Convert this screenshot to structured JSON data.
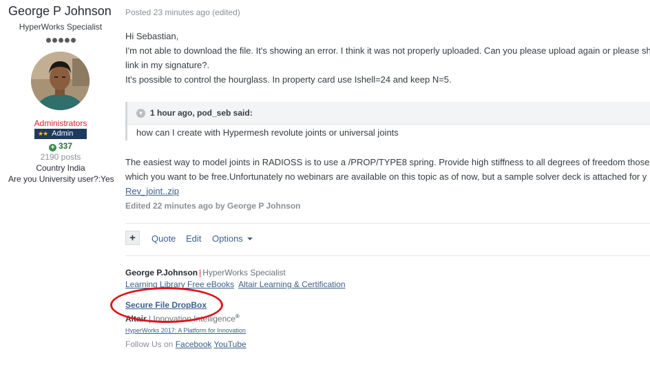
{
  "author": {
    "name": "George P Johnson",
    "title": "HyperWorks Specialist",
    "group": "Administrators",
    "badge_label": "Admin",
    "reputation": "337",
    "posts": "2190 posts",
    "country": "Country India",
    "university": "Are you University user?:Yes"
  },
  "post": {
    "posted": "Posted 23 minutes ago (edited)",
    "lines": [
      "Hi Sebastian,",
      "I'm not able to download the file. It's showing an error. I think it was not properly uploaded. Can you please upload again or please sh",
      "link in my signature?.",
      "It's possible to control the hourglass. In property card use Ishell=24 and keep N=5."
    ],
    "quote": {
      "author": "1 hour ago, pod_seb said:",
      "text": "how can I create with Hypermesh revolute joints or universal joints"
    },
    "answer_lines": [
      " The easiest way to model joints in RADIOSS is to use a /PROP/TYPE8 spring. Provide high stiffness to all degrees of freedom those",
      "which you want to be free.Unfortunately no webinars are available on this topic as of now, but a sample solver deck is attached for y"
    ],
    "attachment": "Rev_joint..zip",
    "edited": "Edited 22 minutes ago by George P Johnson"
  },
  "actions": {
    "plus": "+",
    "quote": "Quote",
    "edit": "Edit",
    "options": "Options"
  },
  "signature": {
    "name": "George P.Johnson",
    "separator": "|",
    "role": "HyperWorks Specialist",
    "links": [
      "Learning Library Free eBooks",
      "Altair Learning & Certification"
    ],
    "dropbox": "Secure File DropBox",
    "brand": "Altair",
    "brand_sep": "|",
    "tagline": "Innovation Intelligence",
    "registered": "®",
    "platform_link": "HyperWorks 2017: A Platform for Innovation",
    "follow_prefix": "Follow Us on",
    "social": [
      "Facebook",
      "YouTube"
    ]
  },
  "colors": {
    "link": "#3b5f8c",
    "admin_red": "#d51f26",
    "highlight_ellipse": "#e0141b"
  }
}
